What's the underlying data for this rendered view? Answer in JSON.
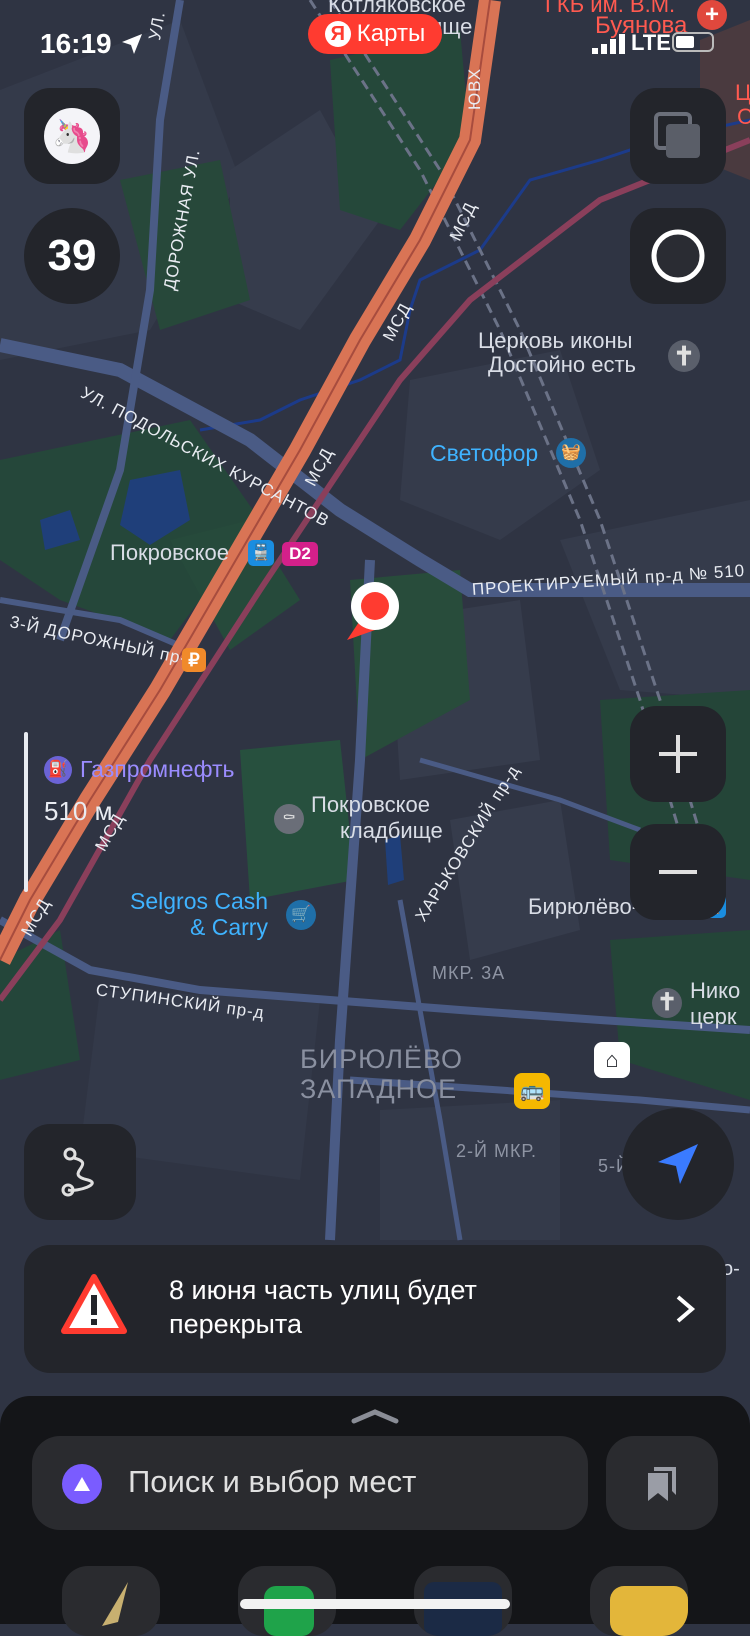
{
  "status_bar": {
    "time": "16:19",
    "network": "LTE"
  },
  "brand": {
    "badge": "Я",
    "name": "Карты"
  },
  "speed": "39",
  "map": {
    "labels": {
      "road_msd_1": "МСД",
      "road_msd_2": "МСД",
      "road_msd_3": "МСД",
      "road_msd_4": "МСД",
      "road_msd_5": "МСД",
      "road_yuvkh": "ЮВХ",
      "road_dorozhnaya": "ДОРОЖНАЯ УЛ.",
      "road_ul_short": "УЛ.",
      "road_podolskikh": "УЛ. ПОДОЛЬСКИХ КУРСАНТОВ",
      "road_3_dorozhny": "3-Й ДОРОЖНЫЙ пр-д",
      "road_proektiruemy": "ПРОЕКТИРУЕМЫЙ пр-д № 510",
      "road_kharkovsky": "ХАРЬКОВСКИЙ пр-д",
      "road_stupinsky": "СТУПИНСКИЙ пр-д",
      "poi_church_1": "Церковь иконы",
      "poi_church_2": "Достойно есть",
      "poi_svetofor": "Светофор",
      "poi_pokrovskoe": "Покровское",
      "poi_d2": "D2",
      "poi_gazprom": "Газпромнефть",
      "poi_cemetery_1": "Покровское",
      "poi_cemetery_2": "кладбище",
      "poi_selgros_1": "Selgros Cash",
      "poi_selgros_2": "& Carry",
      "poi_biryulevo_tov": "Бирюлёво-Тов.",
      "poi_niko_1": "Нико",
      "poi_niko_2": "церк",
      "top_kotlyakovskoe_1": "Котляковское",
      "top_kotlyakovskoe_2": "ище",
      "top_hospital_1": "ГКБ им. В.М.",
      "top_hospital_2": "Буянова",
      "top_edge_1": "Ц",
      "top_edge_2": "С",
      "district_1": "БИРЮЛЁВО",
      "district_2": "ЗАПАДНОЕ",
      "mkr_3a": "МКР. 3А",
      "mkr_2": "2-Й МКР.",
      "mkr_5": "5-Й М",
      "edge_o": "о-",
      "ruble_sign": "₽"
    },
    "scale_text": "510 м"
  },
  "alert": {
    "text": "8 июня часть улиц будет перекрыта"
  },
  "search": {
    "placeholder": "Поиск и выбор мест"
  },
  "colors": {
    "map_bg": "#2f3443",
    "highway": "#d97455",
    "accent_blue": "#3a7bff",
    "brand_red": "#ff3b30",
    "warning_red": "#ff3b30",
    "alice_purple": "#7a5cff"
  }
}
